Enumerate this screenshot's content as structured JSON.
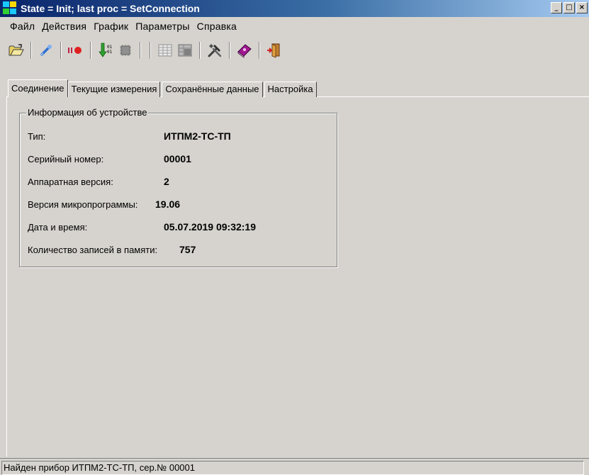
{
  "window": {
    "title": "State = Init; last proc = SetConnection",
    "controls": [
      "_",
      "□",
      "×"
    ]
  },
  "menu": {
    "items": [
      "Файл",
      "Действия",
      "График",
      "Параметры",
      "Справка"
    ]
  },
  "toolbar": {
    "icons": [
      "open-folder-icon",
      "connect-icon",
      "stop-record-icon",
      "read-data-icon",
      "memory-icon",
      "table-icon",
      "grid-icon",
      "tools-icon",
      "help-book-icon",
      "exit-icon"
    ]
  },
  "tabs": {
    "items": [
      "Соединение",
      "Текущие измерения",
      "Сохранённые данные",
      "Настройка"
    ],
    "active": "Соединение"
  },
  "device_info": {
    "title": "Информация об устройстве",
    "rows": [
      {
        "label": "Тип:",
        "value": "ИТПМ2-ТС-ТП"
      },
      {
        "label": "Серийный номер:",
        "value": "00001"
      },
      {
        "label": "Аппаратная версия:",
        "value": "2"
      },
      {
        "label": "Версия микропрограммы:",
        "value": "19.06"
      },
      {
        "label": "Дата и время:",
        "value": "05.07.2019 09:32:19"
      },
      {
        "label": "Количество записей в памяти:",
        "value": "757"
      }
    ]
  },
  "status": {
    "text": "Найден прибор ИТПМ2-ТС-ТП, сер.№ 00001"
  }
}
